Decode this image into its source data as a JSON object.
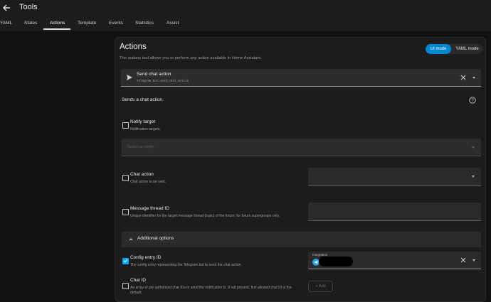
{
  "header": {
    "title": "Tools",
    "tabs": [
      {
        "label": "YAML",
        "active": false
      },
      {
        "label": "States",
        "active": false
      },
      {
        "label": "Actions",
        "active": true
      },
      {
        "label": "Template",
        "active": false
      },
      {
        "label": "Events",
        "active": false
      },
      {
        "label": "Statistics",
        "active": false
      },
      {
        "label": "Assist",
        "active": false
      }
    ]
  },
  "card": {
    "title": "Actions",
    "description": "The actions tool allows you to perform any action available in Home Assistant.",
    "mode_toggle": {
      "ui": "UI mode",
      "yaml": "YAML mode",
      "selected": "ui"
    }
  },
  "action": {
    "name": "Send chat action",
    "id": "telegram_bot.send_chat_action",
    "summary": "Sends a chat action."
  },
  "fields": {
    "notify_target": {
      "label": "Notify target",
      "description": "Notification targets.",
      "placeholder": "Select an entity",
      "checked": false
    },
    "chat_action": {
      "label": "Chat action",
      "description": "Chat action to be sent.",
      "checked": false
    },
    "message_thread_id": {
      "label": "Message thread ID",
      "description": "Unique identifier for the target message thread (topic) of the forum; for forum supergroups only.",
      "checked": false
    },
    "additional_options": {
      "label": "Additional options"
    },
    "config_entry_id": {
      "label": "Config entry ID",
      "description": "The config entry representing the Telegram bot to send the chat action.",
      "value_label": "Integration",
      "checked": true
    },
    "chat_id": {
      "label": "Chat ID",
      "description_line1": "An array of pre-authorized chat IDs to send the notification to. If not present, first allowed chat ID is the",
      "description_line2": "default.",
      "add_label": "+ Add",
      "checked": false
    }
  },
  "colors": {
    "accent": "#03a9f4",
    "toggle_active": "#0288d1",
    "background": "#111111",
    "card": "#1c1c1c"
  },
  "icons": [
    "back-arrow-icon",
    "send-icon",
    "close-icon",
    "chevron-down-icon",
    "help-icon",
    "chevron-up-icon",
    "telegram-icon"
  ]
}
